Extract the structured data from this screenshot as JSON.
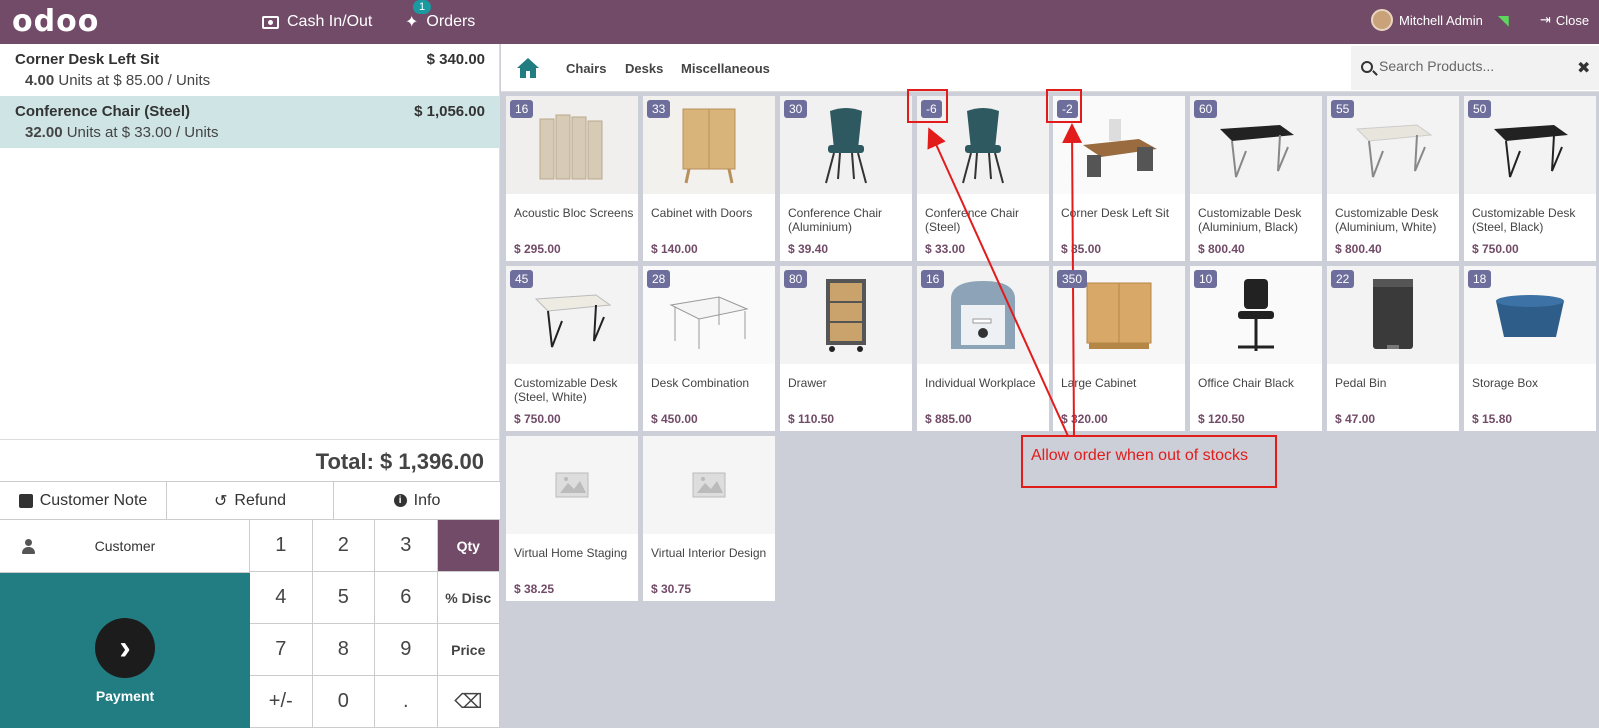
{
  "navbar": {
    "logo": "odoo",
    "cash_label": "Cash In/Out",
    "orders_label": "Orders",
    "orders_badge": "1",
    "user_name": "Mitchell Admin",
    "close_label": "Close"
  },
  "order": {
    "lines": [
      {
        "name": "Corner Desk Left Sit",
        "price": "$ 340.00",
        "qty": "4.00",
        "unit_info": "Units at $ 85.00 / Units"
      },
      {
        "name": "Conference Chair (Steel)",
        "price": "$ 1,056.00",
        "qty": "32.00",
        "unit_info": "Units at $ 33.00 / Units"
      }
    ],
    "total": "Total: $ 1,396.00"
  },
  "actions": {
    "customer_note": "Customer Note",
    "refund": "Refund",
    "info": "Info",
    "customer": "Customer",
    "payment": "Payment"
  },
  "numpad": {
    "keys": [
      "1",
      "2",
      "3",
      "4",
      "5",
      "6",
      "7",
      "8",
      "9",
      "+/-",
      "0",
      "."
    ],
    "modes": [
      "Qty",
      "% Disc",
      "Price"
    ],
    "backspace": "⌫"
  },
  "categories": [
    "Chairs",
    "Desks",
    "Miscellaneous"
  ],
  "search": {
    "placeholder": "Search Products..."
  },
  "products": [
    {
      "name": "Acoustic Bloc Screens",
      "price": "$ 295.00",
      "stock": "16"
    },
    {
      "name": "Cabinet with Doors",
      "price": "$ 140.00",
      "stock": "33"
    },
    {
      "name": "Conference Chair (Aluminium)",
      "price": "$ 39.40",
      "stock": "30"
    },
    {
      "name": "Conference Chair (Steel)",
      "price": "$ 33.00",
      "stock": "-6"
    },
    {
      "name": "Corner Desk Left Sit",
      "price": "$ 85.00",
      "stock": "-2"
    },
    {
      "name": "Customizable Desk (Aluminium, Black)",
      "price": "$ 800.40",
      "stock": "60"
    },
    {
      "name": "Customizable Desk (Aluminium, White)",
      "price": "$ 800.40",
      "stock": "55"
    },
    {
      "name": "Customizable Desk (Steel, Black)",
      "price": "$ 750.00",
      "stock": "50"
    },
    {
      "name": "Customizable Desk (Steel, White)",
      "price": "$ 750.00",
      "stock": "45"
    },
    {
      "name": "Desk Combination",
      "price": "$ 450.00",
      "stock": "28"
    },
    {
      "name": "Drawer",
      "price": "$ 110.50",
      "stock": "80"
    },
    {
      "name": "Individual Workplace",
      "price": "$ 885.00",
      "stock": "16"
    },
    {
      "name": "Large Cabinet",
      "price": "$ 320.00",
      "stock": "350"
    },
    {
      "name": "Office Chair Black",
      "price": "$ 120.50",
      "stock": "10"
    },
    {
      "name": "Pedal Bin",
      "price": "$ 47.00",
      "stock": "22"
    },
    {
      "name": "Storage Box",
      "price": "$ 15.80",
      "stock": "18"
    },
    {
      "name": "Virtual Home Staging",
      "price": "$ 38.25",
      "stock": ""
    },
    {
      "name": "Virtual Interior Design",
      "price": "$ 30.75",
      "stock": ""
    }
  ],
  "annotation": {
    "text": "Allow order when out of stocks"
  },
  "colors": {
    "brand": "#714b67",
    "teal": "#227d83",
    "annotation": "#e21b1b"
  }
}
